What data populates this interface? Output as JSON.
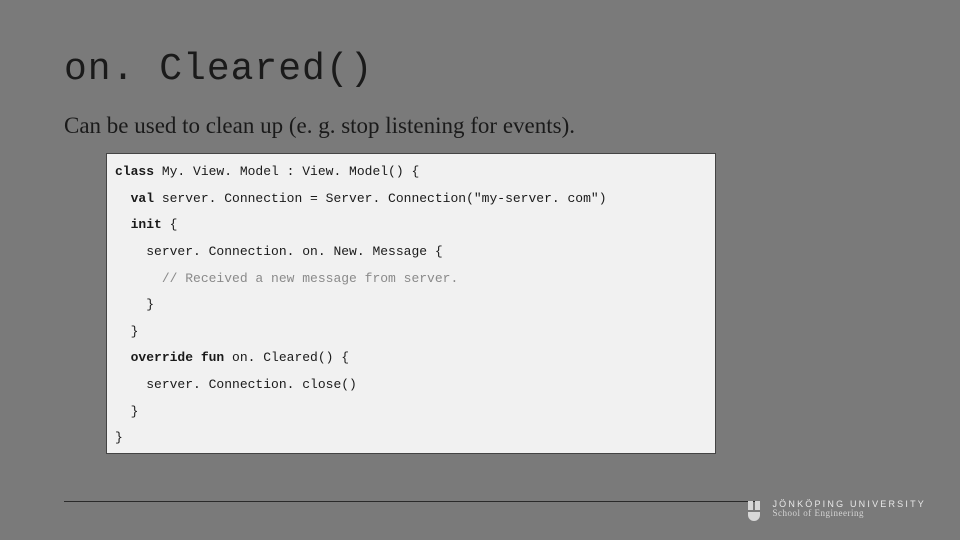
{
  "title": "on. Cleared()",
  "subtitle": "Can be used to clean up (e. g. stop listening for events).",
  "code": {
    "l1_kw": "class",
    "l1_rest": " My. View. Model : View. Model() {",
    "l2_kw": "val",
    "l2_rest": " server. Connection = Server. Connection(\"my-server. com\")",
    "l3_kw": "init",
    "l3_rest": " {",
    "l4": "server. Connection. on. New. Message {",
    "l5_comment": "// Received a new message from server.",
    "l6": "}",
    "l7": "}",
    "l8_kw": "override fun",
    "l8_rest": " on. Cleared() {",
    "l9": "server. Connection. close()",
    "l10": "}",
    "l11": "}"
  },
  "footer": {
    "university": "JÖNKÖPING UNIVERSITY",
    "school": "School of Engineering"
  }
}
